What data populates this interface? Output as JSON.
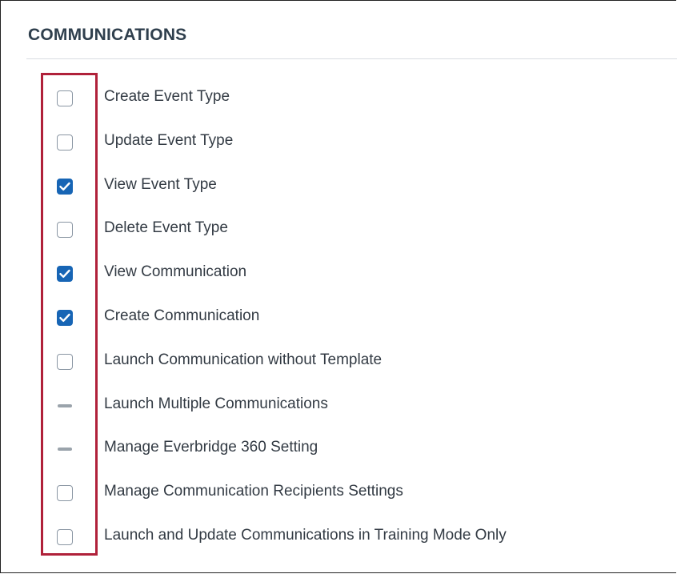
{
  "section": {
    "title": "COMMUNICATIONS"
  },
  "colors": {
    "highlight": "#b0213a",
    "checkbox_checked": "#1765b5",
    "text": "#333b44"
  },
  "permissions": [
    {
      "label": "Create Event Type",
      "state": "unchecked"
    },
    {
      "label": "Update Event Type",
      "state": "unchecked"
    },
    {
      "label": "View Event Type",
      "state": "checked"
    },
    {
      "label": "Delete Event Type",
      "state": "unchecked"
    },
    {
      "label": "View Communication",
      "state": "checked"
    },
    {
      "label": "Create Communication",
      "state": "checked"
    },
    {
      "label": "Launch Communication without Template",
      "state": "unchecked"
    },
    {
      "label": "Launch Multiple Communications",
      "state": "indeterminate"
    },
    {
      "label": "Manage Everbridge 360 Setting",
      "state": "indeterminate"
    },
    {
      "label": "Manage Communication Recipients Settings",
      "state": "unchecked"
    },
    {
      "label": "Launch and Update Communications in Training Mode Only",
      "state": "unchecked"
    }
  ]
}
